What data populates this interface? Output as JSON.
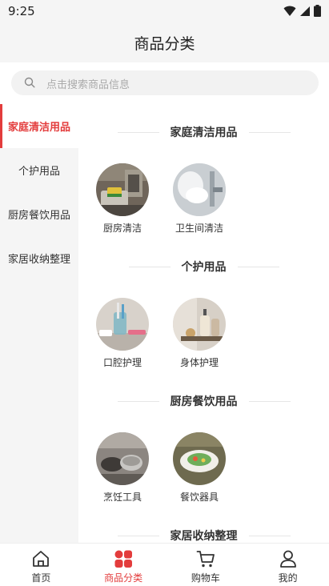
{
  "status_bar": {
    "time": "9:25"
  },
  "header": {
    "title": "商品分类"
  },
  "search": {
    "placeholder": "点击搜索商品信息"
  },
  "sidebar": {
    "items": [
      {
        "label": "家庭清洁用品",
        "active": true
      },
      {
        "label": "个护用品",
        "active": false
      },
      {
        "label": "厨房餐饮用品",
        "active": false
      },
      {
        "label": "家居收纳整理",
        "active": false
      }
    ]
  },
  "sections": [
    {
      "title": "家庭清洁用品",
      "products": [
        {
          "label": "厨房清洁"
        },
        {
          "label": "卫生间清洁"
        }
      ]
    },
    {
      "title": "个护用品",
      "products": [
        {
          "label": "口腔护理"
        },
        {
          "label": "身体护理"
        }
      ]
    },
    {
      "title": "厨房餐饮用品",
      "products": [
        {
          "label": "烹饪工具"
        },
        {
          "label": "餐饮器具"
        }
      ]
    },
    {
      "title": "家居收纳整理",
      "products": []
    }
  ],
  "tabbar": {
    "items": [
      {
        "label": "首页",
        "icon": "home-icon"
      },
      {
        "label": "商品分类",
        "icon": "category-icon",
        "active": true
      },
      {
        "label": "购物车",
        "icon": "cart-icon"
      },
      {
        "label": "我的",
        "icon": "user-icon"
      }
    ]
  },
  "colors": {
    "accent": "#e33c3c",
    "sidebar_bg": "#f5f5f5",
    "text": "#333333"
  }
}
